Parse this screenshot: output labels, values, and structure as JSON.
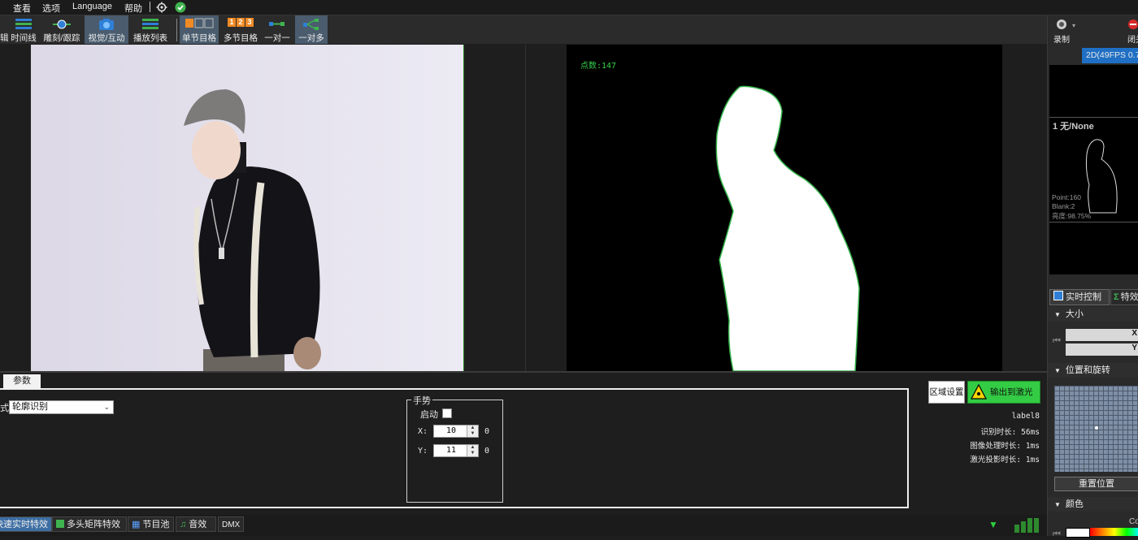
{
  "menu": {
    "items": [
      "查看",
      "选项",
      "Language",
      "帮助"
    ]
  },
  "toolbar": {
    "left_partial": "辑",
    "buttons": [
      {
        "label": "时间线",
        "icon": "timeline-icon"
      },
      {
        "label": "雕刻/跟踪",
        "icon": "tracking-icon"
      },
      {
        "label": "视觉/互动",
        "icon": "camera-icon"
      },
      {
        "label": "播放列表",
        "icon": "playlist-icon"
      },
      {
        "label": "单节目格",
        "icon": "single-grid-icon"
      },
      {
        "label": "多节目格",
        "icon": "multi-grid-icon",
        "digits": [
          "1",
          "2",
          "3"
        ]
      },
      {
        "label": "一对一",
        "icon": "one-to-one-icon"
      },
      {
        "label": "一对多",
        "icon": "one-to-many-icon"
      }
    ]
  },
  "right_toolbar": {
    "record_label": "录制",
    "close_label": "闭关"
  },
  "preview": {
    "point_count": "点数:147"
  },
  "right_panel": {
    "fps_tab": "2D(49FPS 0.7",
    "thumb_title": "1 无/None",
    "thumb_stats": [
      "Point:160",
      "Blank:2",
      "亮度:98.75%"
    ],
    "tabs": [
      "实时控制",
      "特效"
    ],
    "sections": {
      "size": "大小",
      "position": "位置和旋转",
      "color": "颜色"
    },
    "size_fields": [
      "X",
      "Y"
    ],
    "reset_button": "重置位置",
    "color_partial": "Co"
  },
  "params": {
    "tab_label": "参数",
    "mode_label_partial": "式",
    "mode_value": "轮廓识别",
    "gesture_group": "手势",
    "enable_label": "启动",
    "x_label": "X:",
    "x_value": "10",
    "x_extra": "0",
    "y_label": "Y:",
    "y_value": "11",
    "y_extra": "0"
  },
  "actions": {
    "region_button": "区域设置",
    "laser_output_button": "输出到激光",
    "label8": "label8",
    "recognition_time": "识别时长: 56ms",
    "image_processing_time": "图像处理时长: 1ms",
    "laser_projection_time": "激光投影时长: 1ms"
  },
  "bottom_tabs": [
    "快速实时特效",
    "多头矩阵特效",
    "节目池",
    "音效",
    "DMX"
  ],
  "colors": {
    "accent_green": "#35d04a",
    "toolbar_bg": "#2b2b2b",
    "active_btn": "#4a5c6e",
    "fps_blue": "#1f6fc4"
  }
}
